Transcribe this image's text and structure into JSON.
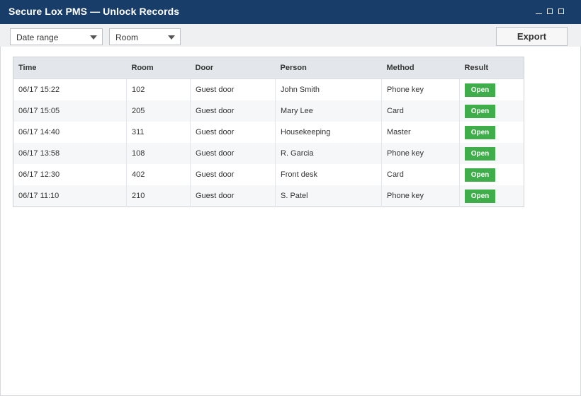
{
  "window": {
    "title": "Secure Lox PMS — Unlock Records"
  },
  "toolbar": {
    "date_range": {
      "selected": "Date range"
    },
    "room": {
      "selected": "Room"
    },
    "export_label": "Export"
  },
  "table": {
    "columns": [
      "Time",
      "Room",
      "Door",
      "Person",
      "Method",
      "Result"
    ],
    "rows": [
      {
        "time": "06/17 15:22",
        "room": "102",
        "door": "Guest door",
        "person": "John Smith",
        "method": "Phone key",
        "result": "Open"
      },
      {
        "time": "06/17 15:05",
        "room": "205",
        "door": "Guest door",
        "person": "Mary Lee",
        "method": "Card",
        "result": "Open"
      },
      {
        "time": "06/17 14:40",
        "room": "311",
        "door": "Guest door",
        "person": "Housekeeping",
        "method": "Master",
        "result": "Open"
      },
      {
        "time": "06/17 13:58",
        "room": "108",
        "door": "Guest door",
        "person": "R. Garcia",
        "method": "Phone key",
        "result": "Open"
      },
      {
        "time": "06/17 12:30",
        "room": "402",
        "door": "Guest door",
        "person": "Front desk",
        "method": "Card",
        "result": "Open"
      },
      {
        "time": "06/17 11:10",
        "room": "210",
        "door": "Guest door",
        "person": "S. Patel",
        "method": "Phone key",
        "result": "Open"
      }
    ]
  },
  "colors": {
    "titlebar": "#183d68",
    "result_open": "#3fae4a"
  }
}
